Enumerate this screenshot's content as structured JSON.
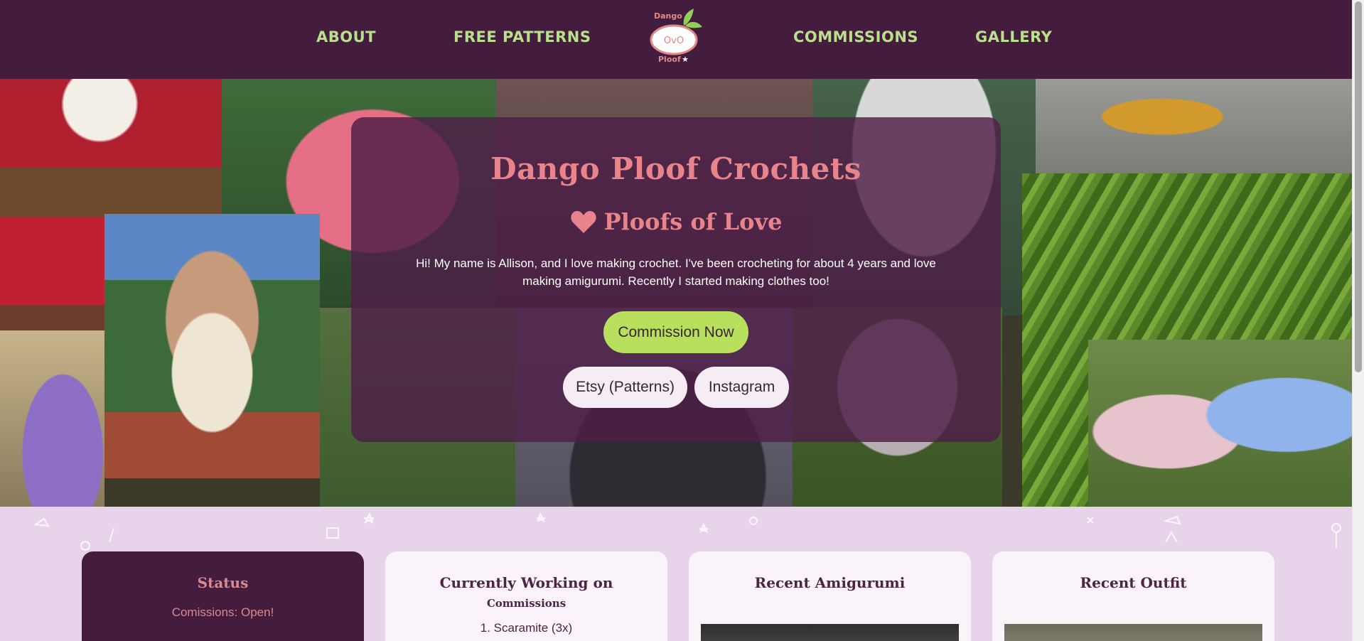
{
  "nav": {
    "links": [
      "ABOUT",
      "FREE PATTERNS",
      "COMMISSIONS",
      "GALLERY"
    ],
    "logo": {
      "top_text": "Dango",
      "bottom_text": "Ploof",
      "face": "OvO",
      "star": "★"
    }
  },
  "hero": {
    "title": "Dango Ploof Crochets",
    "subtitle": "Ploofs of Love",
    "heart_icon": "heart-icon",
    "intro": "Hi! My name is Allison, and I love making crochet. I've been crocheting for about 4 years and love making amigurumi. Recently I started making clothes too!",
    "primary_button": "Commission Now",
    "secondary_buttons": [
      "Etsy (Patterns)",
      "Instagram"
    ]
  },
  "cards": [
    {
      "title": "Status",
      "text": "Comissions: Open!"
    },
    {
      "title": "Currently Working on",
      "subtitle": "Commissions",
      "text": "1. Scaramite (3x)"
    },
    {
      "title": "Recent Amigurumi"
    },
    {
      "title": "Recent Outfit"
    }
  ],
  "colors": {
    "nav_bg": "#441c3e",
    "nav_link": "#b9e08a",
    "accent_pink": "#e9848c",
    "primary_button": "#b8e05c",
    "lower_bg": "#e7d3ea"
  }
}
